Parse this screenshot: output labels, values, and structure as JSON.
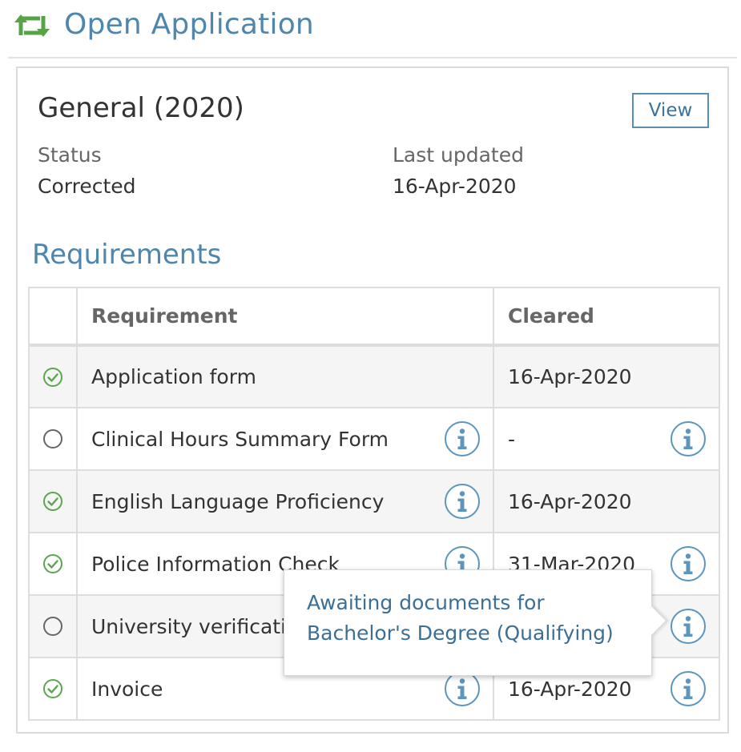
{
  "header": {
    "title": "Open Application",
    "icon": "retweet-icon",
    "accent_color": "#56a446"
  },
  "application": {
    "title": "General (2020)",
    "view_label": "View",
    "status_label": "Status",
    "status_value": "Corrected",
    "updated_label": "Last updated",
    "updated_value": "16-Apr-2020"
  },
  "requirements": {
    "heading": "Requirements",
    "columns": {
      "status": "",
      "requirement": "Requirement",
      "cleared": "Cleared"
    },
    "rows": [
      {
        "status": "check",
        "requirement": "Application form",
        "cleared": "16-Apr-2020",
        "req_info": false,
        "cleared_info": false
      },
      {
        "status": "open",
        "requirement": "Clinical Hours Summary Form",
        "cleared": "-",
        "req_info": true,
        "cleared_info": true
      },
      {
        "status": "check",
        "requirement": "English Language Proficiency",
        "cleared": "16-Apr-2020",
        "req_info": true,
        "cleared_info": false
      },
      {
        "status": "check",
        "requirement": "Police Information Check",
        "cleared": "31-Mar-2020",
        "req_info": true,
        "cleared_info": true
      },
      {
        "status": "open",
        "requirement": "University verification",
        "cleared": "",
        "req_info": false,
        "cleared_info": true
      },
      {
        "status": "check",
        "requirement": "Invoice",
        "cleared": "16-Apr-2020",
        "req_info": true,
        "cleared_info": true
      }
    ]
  },
  "tooltip": {
    "line1": "Awaiting documents for",
    "line2": "Bachelor's Degree (Qualifying)"
  },
  "colors": {
    "check": "#5aa64c",
    "open": "#666666",
    "info": "#5c95bd",
    "link": "#4e86ad"
  }
}
